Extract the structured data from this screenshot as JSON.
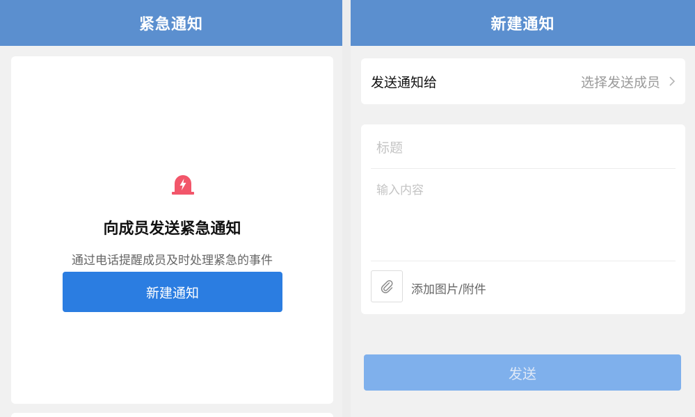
{
  "left": {
    "header_title": "紧急通知",
    "icon": "alarm-siren-icon",
    "card_title": "向成员发送紧急通知",
    "card_desc": "通过电话提醒成员及时处理紧急的事件",
    "new_button_label": "新建通知"
  },
  "right": {
    "header_title": "新建通知",
    "recipient_label": "发送通知给",
    "recipient_value": "选择发送成员",
    "title_placeholder": "标题",
    "content_placeholder": "输入内容",
    "attach_icon": "paperclip-icon",
    "attach_label": "添加图片/附件",
    "send_button_label": "发送"
  },
  "colors": {
    "header": "#5b8fcf",
    "primary_button": "#2b7de1",
    "disabled_button": "#7fb0ec",
    "alarm": "#f2566a"
  }
}
